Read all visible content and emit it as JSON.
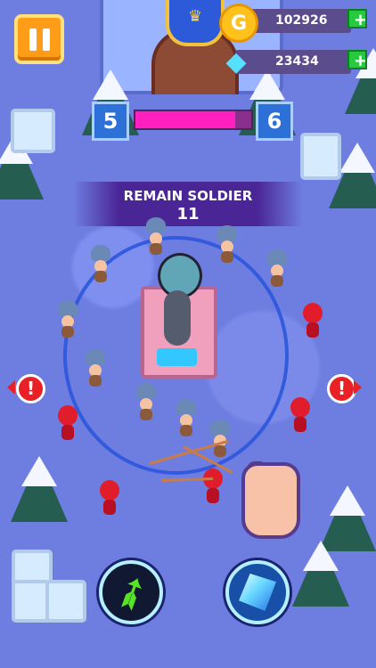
{
  "hud": {
    "coin_count": "102926",
    "gem_count": "23434",
    "current_level": "5",
    "next_level": "6",
    "level_progress": 0.86
  },
  "banner": {
    "title": "REMAIN SOLDIER",
    "count": "11"
  },
  "alerts": [
    "!",
    "!"
  ],
  "icons": {
    "pause": "pause-icon",
    "coin": "coin-icon",
    "gem": "gem-icon",
    "plus": "plus-icon",
    "arrow_skill": "arrow-volley-icon",
    "ice_skill": "ice-crystal-icon"
  },
  "colors": {
    "ground": "#6f7fe0",
    "progress": "#ff20bf",
    "level_box": "#2d70d7",
    "warning": "#e92025"
  }
}
